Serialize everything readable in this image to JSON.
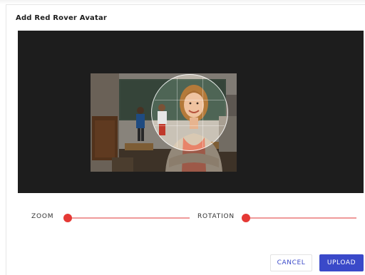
{
  "dialog": {
    "title": "Add Red Rover Avatar"
  },
  "image": {
    "description_icon": "avatar-photo"
  },
  "controls": {
    "zoom_label": "ZOOM",
    "zoom_value": 0,
    "rotation_label": "ROTATION",
    "rotation_value": 0
  },
  "buttons": {
    "cancel_label": "CANCEL",
    "upload_label": "UPLOAD"
  },
  "colors": {
    "accent": "#3a49c9",
    "slider": "#e53935",
    "slider_track": "#ef9a9a",
    "crop_background": "#1d1d1d"
  }
}
